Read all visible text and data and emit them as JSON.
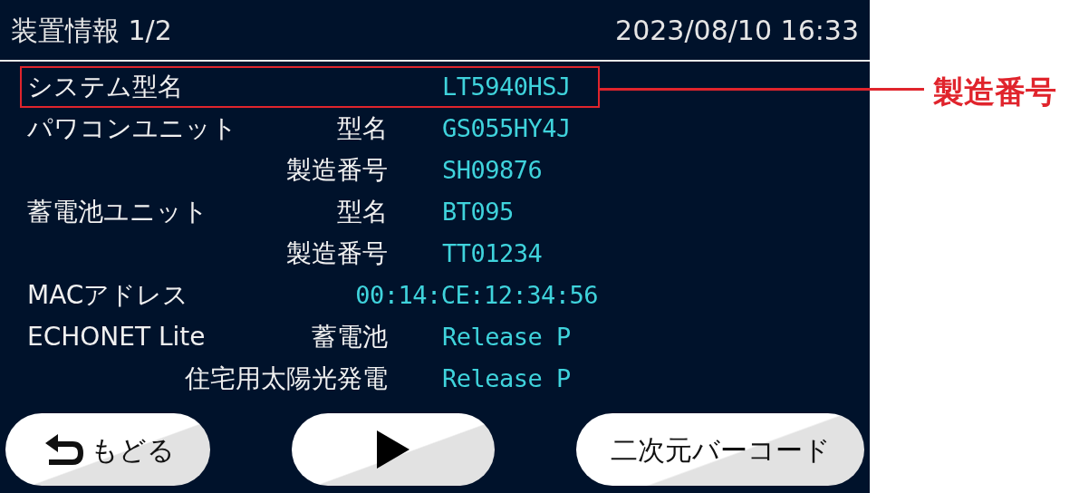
{
  "header": {
    "title": "装置情報 1/2",
    "datetime": "2023/08/10 16:33"
  },
  "rows": [
    {
      "label": "システム型名",
      "value": "LT5940HSJ",
      "highlighted": true
    },
    {
      "label": "パワコンユニット",
      "sublabel": "型名",
      "value": "GS055HY4J",
      "highlighted": false
    },
    {
      "sublabel": "製造番号",
      "value": "SH09876",
      "highlighted": false
    },
    {
      "label": "蓄電池ユニット",
      "sublabel": "型名",
      "value": "BT095",
      "highlighted": false
    },
    {
      "sublabel": "製造番号",
      "value": "TT01234",
      "highlighted": false
    },
    {
      "label": "MACアドレス",
      "value": "00:14:CE:12:34:56",
      "highlighted": false
    },
    {
      "label": "ECHONET Lite",
      "sublabel": "蓄電池",
      "value": "Release P",
      "highlighted": false
    },
    {
      "sublabel": "住宅用太陽光発電",
      "value": "Release P",
      "highlighted": false
    }
  ],
  "buttons": [
    {
      "kind": "back",
      "label": "もどる"
    },
    {
      "kind": "next"
    },
    {
      "kind": "text",
      "label": "二次元バーコード"
    }
  ],
  "annotation": {
    "label": "製造番号"
  }
}
